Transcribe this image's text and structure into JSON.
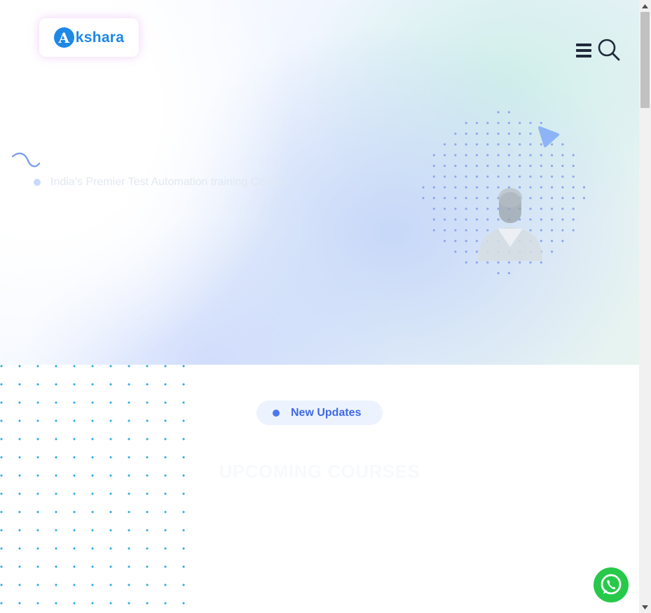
{
  "header": {
    "logo_text": "kshara",
    "logo_badge": "A",
    "menu_icon": "hamburger-icon",
    "search_icon": "search-icon"
  },
  "hero": {
    "tagline": "India’s Premier Test Automation training Center",
    "decor_icons": [
      "squiggle-icon",
      "play-icon",
      "instructor-photo"
    ]
  },
  "updates": {
    "label": "New Updates"
  },
  "section": {
    "title": "UPCOMING COURSES"
  },
  "widgets": {
    "whatsapp_icon": "whatsapp-icon"
  },
  "colors": {
    "brand_blue": "#1e88e5",
    "accent_blue": "#3f6ae4",
    "dot_cyan": "#2aaae8",
    "whatsapp_green": "#27c94a"
  }
}
